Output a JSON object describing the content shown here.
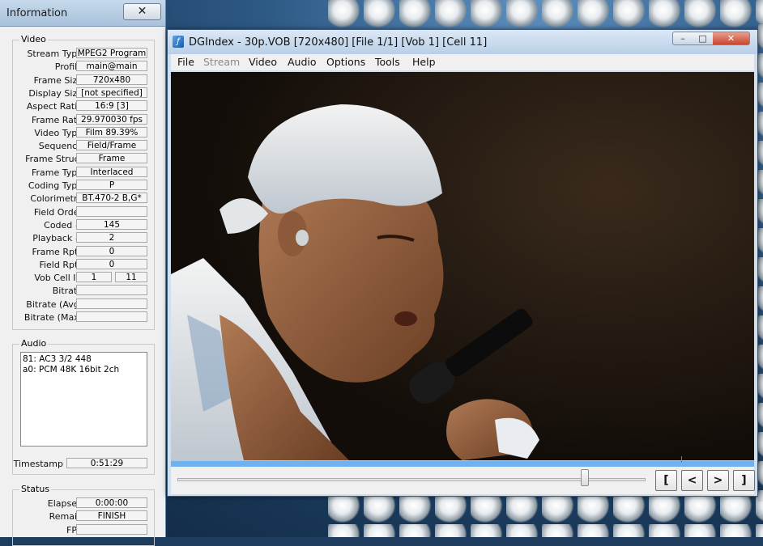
{
  "info_window": {
    "title": "Information",
    "close_glyph": "✕",
    "video_group": {
      "label": "Video",
      "fields": [
        {
          "label": "Stream Type",
          "value": "MPEG2 Program"
        },
        {
          "label": "Profile",
          "value": "main@main"
        },
        {
          "label": "Frame Size",
          "value": "720x480"
        },
        {
          "label": "Display Size",
          "value": "[not specified]"
        },
        {
          "label": "Aspect Ratio",
          "value": "16:9 [3]"
        },
        {
          "label": "Frame Rate",
          "value": "29.970030 fps"
        },
        {
          "label": "Video Type",
          "value": "Film 89.39%"
        },
        {
          "label": "Sequence",
          "value": "Field/Frame"
        },
        {
          "label": "Frame Struct",
          "value": "Frame"
        },
        {
          "label": "Frame Type",
          "value": "Interlaced"
        },
        {
          "label": "Coding Type",
          "value": "P"
        },
        {
          "label": "Colorimetry",
          "value": "BT.470-2 B,G*"
        },
        {
          "label": "Field Order",
          "value": ""
        },
        {
          "label": "Coded #",
          "value": "145"
        },
        {
          "label": "Playback #",
          "value": "2"
        },
        {
          "label": "Frame Rpts",
          "value": "0"
        },
        {
          "label": "Field Rpts",
          "value": "0"
        },
        {
          "label": "Vob Cell ID",
          "value": "1",
          "value2": "11"
        },
        {
          "label": "Bitrate",
          "value": ""
        },
        {
          "label": "Bitrate (Avg)",
          "value": ""
        },
        {
          "label": "Bitrate (Max)",
          "value": ""
        }
      ]
    },
    "audio_group": {
      "label": "Audio",
      "tracks": [
        "81: AC3 3/2 448",
        "a0: PCM 48K 16bit 2ch"
      ],
      "timestamp_label": "Timestamp",
      "timestamp_value": "0:51:29"
    },
    "status_group": {
      "label": "Status",
      "fields": [
        {
          "label": "Elapsed",
          "value": "0:00:00"
        },
        {
          "label": "Remain",
          "value": "FINISH"
        },
        {
          "label": "FPS",
          "value": ""
        }
      ]
    }
  },
  "main_window": {
    "icon_glyph": "ƒ",
    "title": "DGIndex - 30p.VOB [720x480] [File 1/1] [Vob 1] [Cell 11]",
    "caption_buttons": {
      "minimize": "–",
      "maximize": "□",
      "close": "✕"
    },
    "menu": [
      {
        "label": "File",
        "enabled": true
      },
      {
        "label": "Stream",
        "enabled": false
      },
      {
        "label": "Video",
        "enabled": true
      },
      {
        "label": "Audio",
        "enabled": true
      },
      {
        "label": "Options",
        "enabled": true
      },
      {
        "label": "Tools",
        "enabled": true
      },
      {
        "label": "Help",
        "enabled": true
      }
    ],
    "progress_fraction": 1.0,
    "slider_position_fraction": 0.87,
    "nav_buttons": [
      "[",
      "<",
      ">",
      "]"
    ]
  }
}
